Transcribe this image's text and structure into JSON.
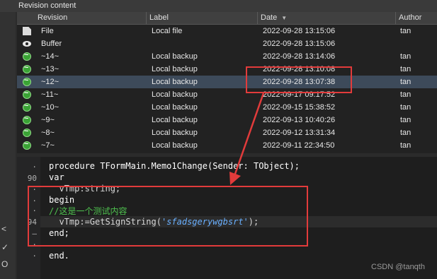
{
  "window": {
    "title": "Revision content"
  },
  "left_strip": {
    "glyphs": [
      "<",
      "✓",
      "O"
    ]
  },
  "table": {
    "headers": {
      "revision": "Revision",
      "label": "Label",
      "date": "Date",
      "author": "Author"
    },
    "sort_column": "Date",
    "rows": [
      {
        "icon": "file-icon",
        "revision": "File",
        "label": "Local file",
        "date": "2022-09-28 13:15:06",
        "author": "tan"
      },
      {
        "icon": "eye-icon",
        "revision": "Buffer",
        "label": "",
        "date": "2022-09-28 13:15:06",
        "author": ""
      },
      {
        "icon": "backup-icon",
        "revision": "~14~",
        "label": "Local backup",
        "date": "2022-09-28 13:14:06",
        "author": "tan"
      },
      {
        "icon": "backup-icon",
        "revision": "~13~",
        "label": "Local backup",
        "date": "2022-09-28 13:10:08",
        "author": "tan"
      },
      {
        "icon": "backup-icon",
        "revision": "~12~",
        "label": "Local backup",
        "date": "2022-09-28 13:07:38",
        "author": "tan"
      },
      {
        "icon": "backup-icon",
        "revision": "~11~",
        "label": "Local backup",
        "date": "2022-09-17 09:17:52",
        "author": "tan"
      },
      {
        "icon": "backup-icon",
        "revision": "~10~",
        "label": "Local backup",
        "date": "2022-09-15 15:38:52",
        "author": "tan"
      },
      {
        "icon": "backup-icon",
        "revision": "~9~",
        "label": "Local backup",
        "date": "2022-09-13 10:40:26",
        "author": "tan"
      },
      {
        "icon": "backup-icon",
        "revision": "~8~",
        "label": "Local backup",
        "date": "2022-09-12 13:31:34",
        "author": "tan"
      },
      {
        "icon": "backup-icon",
        "revision": "~7~",
        "label": "Local backup",
        "date": "2022-09-11 22:34:50",
        "author": "tan"
      }
    ]
  },
  "editor": {
    "gutter": [
      "·",
      "90",
      "·",
      "·",
      "·",
      "94",
      "–",
      "·",
      "·"
    ],
    "lines": {
      "l1": "procedure TFormMain.Memo1Change(Sender: TObject);",
      "l2": "var",
      "l3": "  vTmp:string;",
      "l4": "begin",
      "l5": "//这是一个测试内容",
      "l6a": "  vTmp:=GetSignString(",
      "l6b": "'sfadsgerywgbsrt'",
      "l6c": ");",
      "l7": "end;",
      "l8": "",
      "l9": "end."
    }
  },
  "watermark": "CSDN @tanqth",
  "colors": {
    "highlight_box": "#e23b3b",
    "comment": "#4fc24f",
    "string": "#6ab0ff",
    "selected_row": "#3d4a5a"
  }
}
